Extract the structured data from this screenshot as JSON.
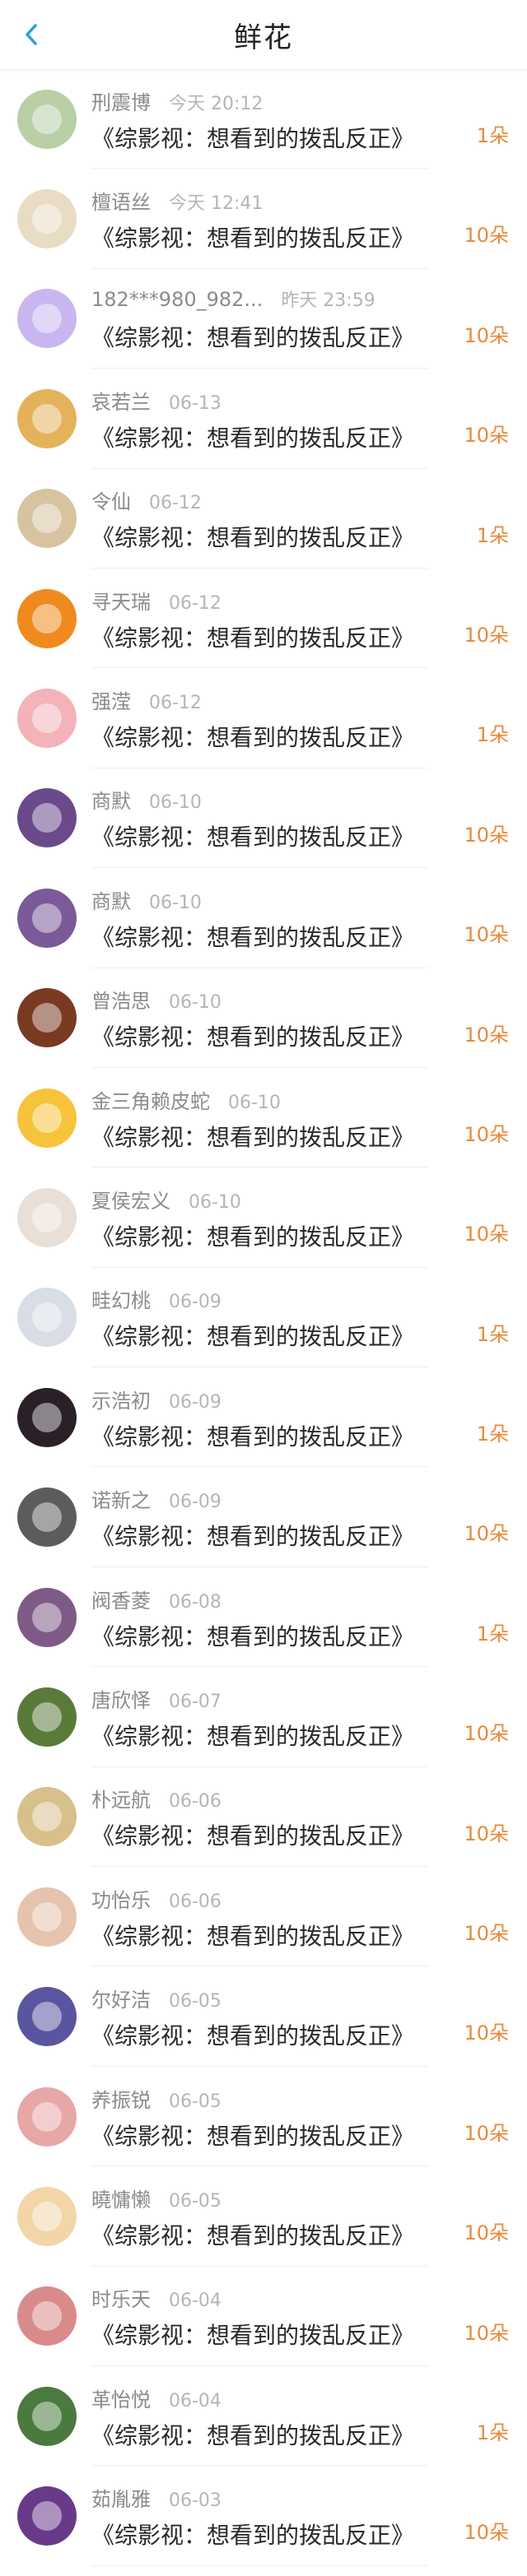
{
  "header": {
    "title": "鲜花",
    "back_icon": "chevron-left-icon"
  },
  "accent": "#e88a3a",
  "rows": [
    {
      "name": "刑震博",
      "time": "今天 20:12",
      "work": "《综影视：想看到的拨乱反正》",
      "amount": "1朵",
      "avatar_color": "#b9cfa6"
    },
    {
      "name": "檀语丝",
      "time": "今天 12:41",
      "work": "《综影视：想看到的拨乱反正》",
      "amount": "10朵",
      "avatar_color": "#e9dcc4"
    },
    {
      "name": "182***980_982...",
      "time": "昨天 23:59",
      "work": "《综影视：想看到的拨乱反正》",
      "amount": "10朵",
      "avatar_color": "#c9b6f0"
    },
    {
      "name": "哀若兰",
      "time": "06-13",
      "work": "《综影视：想看到的拨乱反正》",
      "amount": "10朵",
      "avatar_color": "#e4b25b"
    },
    {
      "name": "令仙",
      "time": "06-12",
      "work": "《综影视：想看到的拨乱反正》",
      "amount": "1朵",
      "avatar_color": "#d8c3a0"
    },
    {
      "name": "寻天瑞",
      "time": "06-12",
      "work": "《综影视：想看到的拨乱反正》",
      "amount": "10朵",
      "avatar_color": "#f08a1e"
    },
    {
      "name": "强滢",
      "time": "06-12",
      "work": "《综影视：想看到的拨乱反正》",
      "amount": "1朵",
      "avatar_color": "#f3b3b8"
    },
    {
      "name": "商默",
      "time": "06-10",
      "work": "《综影视：想看到的拨乱反正》",
      "amount": "10朵",
      "avatar_color": "#6a4a8a"
    },
    {
      "name": "商默",
      "time": "06-10",
      "work": "《综影视：想看到的拨乱反正》",
      "amount": "10朵",
      "avatar_color": "#7a5a98"
    },
    {
      "name": "曾浩思",
      "time": "06-10",
      "work": "《综影视：想看到的拨乱反正》",
      "amount": "10朵",
      "avatar_color": "#7a3a22"
    },
    {
      "name": "金三角赖皮蛇",
      "time": "06-10",
      "work": "《综影视：想看到的拨乱反正》",
      "amount": "10朵",
      "avatar_color": "#f6c33b"
    },
    {
      "name": "夏侯宏义",
      "time": "06-10",
      "work": "《综影视：想看到的拨乱反正》",
      "amount": "10朵",
      "avatar_color": "#eadfd6"
    },
    {
      "name": "畦幻桃",
      "time": "06-09",
      "work": "《综影视：想看到的拨乱反正》",
      "amount": "1朵",
      "avatar_color": "#d9dde6"
    },
    {
      "name": "示浩初",
      "time": "06-09",
      "work": "《综影视：想看到的拨乱反正》",
      "amount": "1朵",
      "avatar_color": "#2a2128"
    },
    {
      "name": "诺新之",
      "time": "06-09",
      "work": "《综影视：想看到的拨乱反正》",
      "amount": "10朵",
      "avatar_color": "#5c5c5c"
    },
    {
      "name": "阀香菱",
      "time": "06-08",
      "work": "《综影视：想看到的拨乱反正》",
      "amount": "1朵",
      "avatar_color": "#7e5a86"
    },
    {
      "name": "唐欣怿",
      "time": "06-07",
      "work": "《综影视：想看到的拨乱反正》",
      "amount": "10朵",
      "avatar_color": "#5a7a3a"
    },
    {
      "name": "朴远航",
      "time": "06-06",
      "work": "《综影视：想看到的拨乱反正》",
      "amount": "10朵",
      "avatar_color": "#d7c08a"
    },
    {
      "name": "功怡乐",
      "time": "06-06",
      "work": "《综影视：想看到的拨乱反正》",
      "amount": "10朵",
      "avatar_color": "#e6c3ad"
    },
    {
      "name": "尔好洁",
      "time": "06-05",
      "work": "《综影视：想看到的拨乱反正》",
      "amount": "10朵",
      "avatar_color": "#5a55a0"
    },
    {
      "name": "养振锐",
      "time": "06-05",
      "work": "《综影视：想看到的拨乱反正》",
      "amount": "10朵",
      "avatar_color": "#e7a7a7"
    },
    {
      "name": "曉慵懒",
      "time": "06-05",
      "work": "《综影视：想看到的拨乱反正》",
      "amount": "10朵",
      "avatar_color": "#f2d6a8"
    },
    {
      "name": "时乐天",
      "time": "06-04",
      "work": "《综影视：想看到的拨乱反正》",
      "amount": "10朵",
      "avatar_color": "#d98b8b"
    },
    {
      "name": "革怡悦",
      "time": "06-04",
      "work": "《综影视：想看到的拨乱反正》",
      "amount": "1朵",
      "avatar_color": "#4a7a3e"
    },
    {
      "name": "茹胤雅",
      "time": "06-03",
      "work": "《综影视：想看到的拨乱反正》",
      "amount": "10朵",
      "avatar_color": "#6a3a8a"
    }
  ]
}
